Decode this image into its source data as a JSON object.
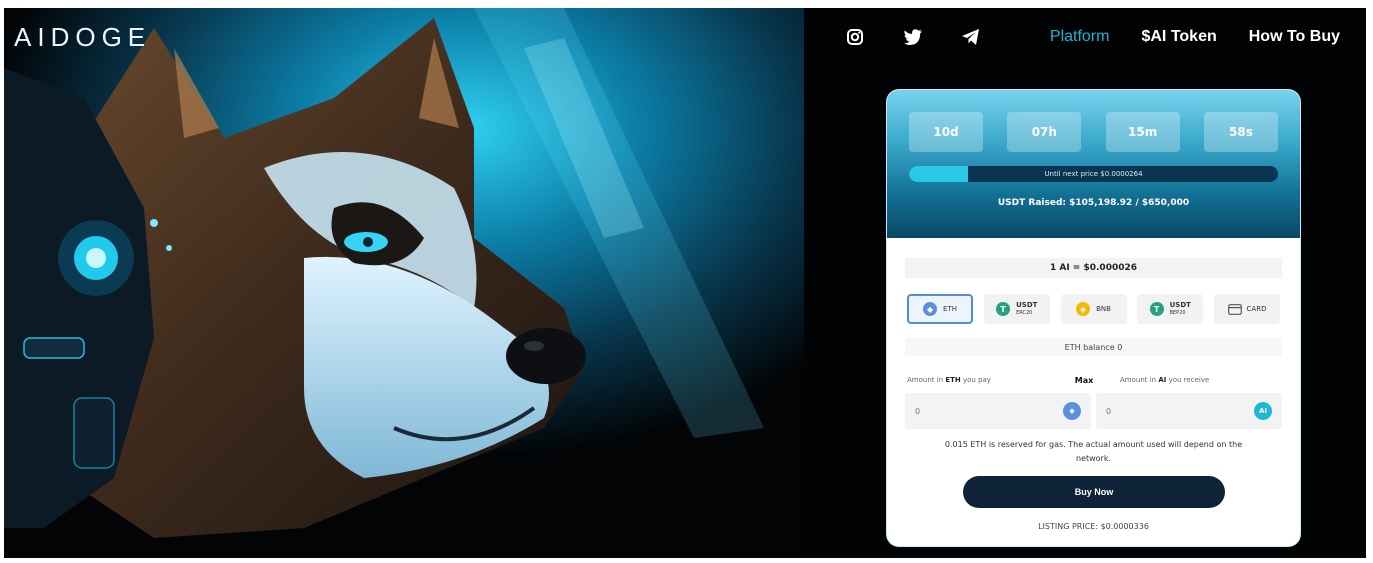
{
  "brand": {
    "logo_text": "AIDOGE"
  },
  "nav": {
    "social_icons": [
      "instagram-icon",
      "twitter-icon",
      "telegram-icon"
    ],
    "links": [
      {
        "label": "Platform",
        "active": true
      },
      {
        "label": "$AI Token",
        "active": false
      },
      {
        "label": "How To Buy",
        "active": false
      }
    ]
  },
  "presale": {
    "countdown": [
      "10d",
      "07h",
      "15m",
      "58s"
    ],
    "progress_fraction": 0.16,
    "progress_label": "Until next price $0.0000264",
    "raised_text": "USDT Raised: $105,198.92 / $650,000",
    "rate_text": "1 AI = $0.000026",
    "currencies": [
      {
        "label": "ETH",
        "sub": "",
        "icon": "eth-icon",
        "selected": true
      },
      {
        "label": "USDT",
        "sub": "ERC20",
        "icon": "tether-icon",
        "selected": false
      },
      {
        "label": "BNB",
        "sub": "",
        "icon": "bnb-icon",
        "selected": false
      },
      {
        "label": "USDT",
        "sub": "BEP20",
        "icon": "tether-icon",
        "selected": false
      },
      {
        "label": "CARD",
        "sub": "",
        "icon": "card-icon",
        "selected": false
      }
    ],
    "balance_text": "ETH balance 0",
    "pay_label_prefix": "Amount in ",
    "pay_label_token": "ETH",
    "pay_label_suffix": " you pay",
    "max_label": "Max",
    "receive_label_prefix": "Amount in ",
    "receive_label_token": "AI",
    "receive_label_suffix": " you receive",
    "pay_value": "0",
    "receive_value": "0",
    "gas_note": "0.015 ETH is reserved for gas. The actual amount used will depend on the network.",
    "buy_label": "Buy Now",
    "listing_text": "LISTING PRICE: $0.0000336"
  },
  "colors": {
    "accent": "#1fb2d6",
    "button_dark": "#0e2238",
    "eth": "#5a8fe0",
    "tether": "#26a17b",
    "bnb": "#f0b90b",
    "ai_token": "#20b7d4"
  }
}
